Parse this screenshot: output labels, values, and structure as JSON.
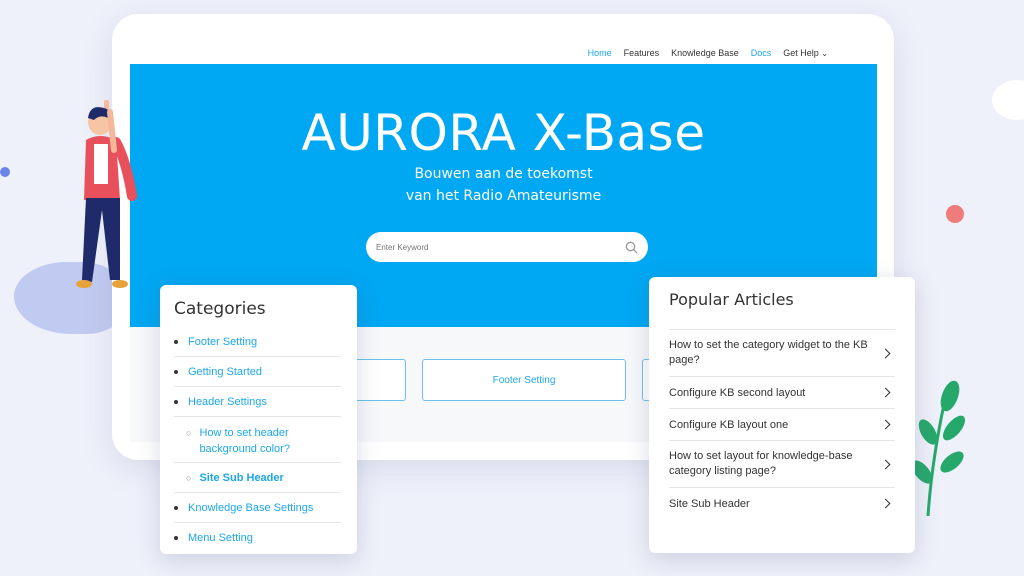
{
  "nav": {
    "items": [
      "Home",
      "Features",
      "Knowledge Base",
      "Docs",
      "Get Help"
    ],
    "dropdown_icon": "chevron-down-icon"
  },
  "hero": {
    "title": "AURORA X-Base",
    "subtitle_line1": "Bouwen aan de toekomst",
    "subtitle_line2": "van het Radio Amateurisme"
  },
  "search": {
    "placeholder": "Enter Keyword",
    "icon": "search-icon"
  },
  "category_boxes": [
    "Footer Setting"
  ],
  "categories": {
    "title": "Categories",
    "items": [
      {
        "label": "Footer Setting",
        "level": 1
      },
      {
        "label": "Getting Started",
        "level": 1
      },
      {
        "label": "Header Settings",
        "level": 1
      },
      {
        "label": "How to set header background color?",
        "level": 2
      },
      {
        "label": "Site Sub Header",
        "level": 2,
        "bold": true
      },
      {
        "label": "Knowledge Base Settings",
        "level": 1
      },
      {
        "label": "Menu Setting",
        "level": 1
      }
    ]
  },
  "popular": {
    "title": "Popular Articles",
    "items": [
      "How to set the category widget to the KB page?",
      "Configure KB second layout",
      "Configure KB layout one",
      "How to set layout for knowledge-base category listing page?",
      "Site Sub Header"
    ]
  },
  "colors": {
    "hero_blue": "#00a7f2",
    "link_blue": "#1ea7e8",
    "background": "#eef0fa",
    "coral_dot": "#f07b7b",
    "leaf_green": "#27a86b"
  }
}
